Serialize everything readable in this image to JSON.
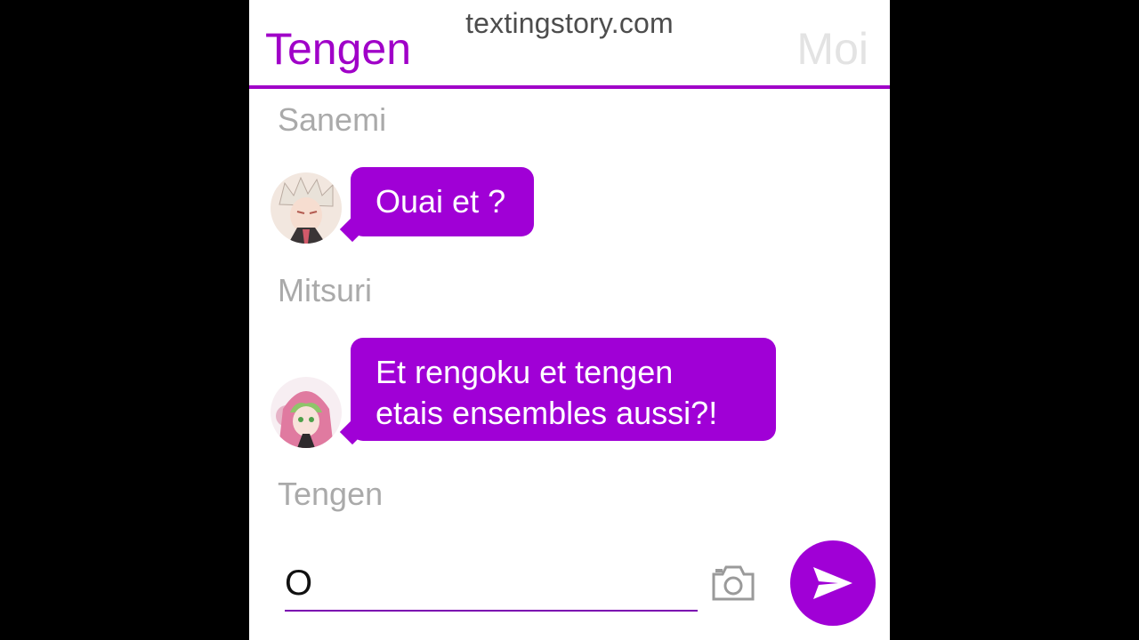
{
  "watermark": "textingstory.com",
  "header": {
    "contact_name": "Tengen",
    "self_label": "Moi"
  },
  "messages": [
    {
      "sender": "Sanemi",
      "text": "Ouai et ?"
    },
    {
      "sender": "Mitsuri",
      "lines": [
        "Et rengoku et tengen",
        "etais ensembles aussi?!"
      ]
    }
  ],
  "typing_sender": "Tengen",
  "composer": {
    "value": "O",
    "camera_icon": "camera-icon",
    "send_icon": "send-icon"
  },
  "colors": {
    "accent": "#a000d6",
    "header_accent": "#a000c8",
    "background": "#000000"
  }
}
